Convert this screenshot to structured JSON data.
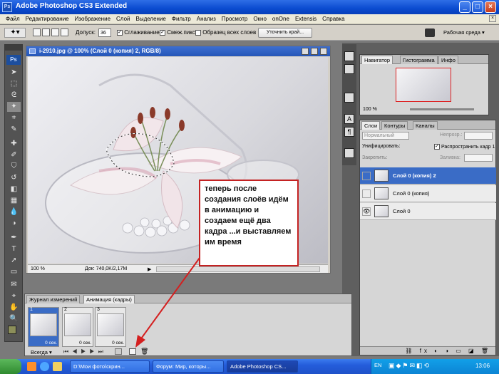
{
  "window": {
    "title": "Adobe Photoshop CS3 Extended",
    "app_icon": "Ps"
  },
  "menu": [
    "Файл",
    "Редактирование",
    "Изображение",
    "Слой",
    "Выделение",
    "Фильтр",
    "Анализ",
    "Просмотр",
    "Окно",
    "onOne",
    "Extensis",
    "Справка"
  ],
  "options": {
    "tolerance_label": "Допуск:",
    "tolerance_value": "36",
    "antialias": "Сглаживание",
    "contiguous": "Смеж.пикс",
    "sample_all": "Образец всех слоев",
    "refine_button": "Уточнить край...",
    "workspace": "Рабочая среда"
  },
  "tools": {
    "logo": "Ps"
  },
  "document": {
    "title": "i-2910.jpg @ 100% (Слой 0 (копия) 2, RGB/8)",
    "zoom": "100 %",
    "doc_info": "Док: 740,0K/2,17M"
  },
  "annotation": "теперь после создания слоёв идём в анимацию и создаем ещё два кадра ...и выставляем им время",
  "navigator": {
    "tabs": [
      "Навигатор",
      "Гистограмма",
      "Инфо"
    ],
    "zoom": "100 %"
  },
  "layers": {
    "tabs": [
      "Слои",
      "Контуры",
      "Каналы"
    ],
    "blend_mode": "Нормальный",
    "opacity_label": "Непрозр.:",
    "unify_label": "Унифицировать:",
    "propagate_label": "Распространить кадр 1",
    "lock_label": "Закрепить:",
    "fill_label": "Заливка:",
    "items": [
      {
        "name": "Слой 0 (копия) 2",
        "selected": true,
        "visible": false
      },
      {
        "name": "Слой 0 (копия)",
        "selected": false,
        "visible": false
      },
      {
        "name": "Слой 0",
        "selected": false,
        "visible": true
      }
    ]
  },
  "animation": {
    "tabs": [
      "Журнал измерений",
      "Анимация (кадры)"
    ],
    "loop": "Всегда",
    "frames": [
      {
        "num": "1",
        "delay": "0 сек."
      },
      {
        "num": "2",
        "delay": "0 сек."
      },
      {
        "num": "3",
        "delay": "0 сек."
      }
    ]
  },
  "taskbar": {
    "tasks": [
      "D:\\Мои фото\\скрин...",
      "Форум: Мир, которы...",
      "Adobe Photoshop CS..."
    ],
    "lang": "EN",
    "clock": "13:06"
  },
  "colors": {
    "accent": "#3a6cc6",
    "annotation_border": "#c42222",
    "arrow": "#d41f1f"
  }
}
